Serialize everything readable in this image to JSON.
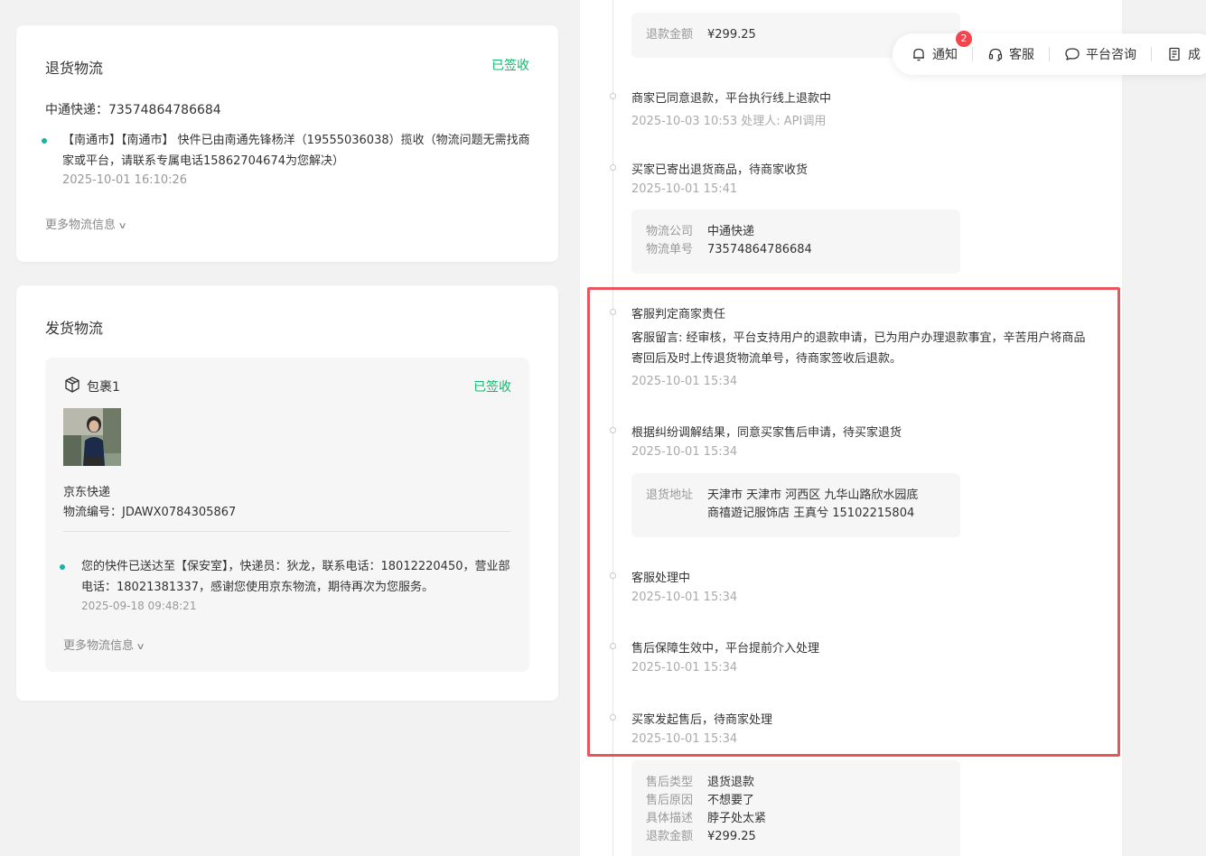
{
  "return_logistics": {
    "title": "退货物流",
    "status": "已签收",
    "tracking": "中通快递：73574864786684",
    "log_text": "【南通市】【南通市】 快件已由南通先锋杨洋（19555036038）揽收（物流问题无需找商家或平台，请联系专属电话15862704674为您解决）",
    "log_time": "2025-10-01 16:10:26",
    "more": "更多物流信息"
  },
  "ship_logistics": {
    "title": "发货物流",
    "package": {
      "label": "包裹1",
      "status": "已签收",
      "carrier": "京东快递",
      "tracking": "物流编号：JDAWX0784305867",
      "log_text": "您的快件已送达至【保安室】，快递员：狄龙，联系电话：18012220450，营业部电话：18021381337，感谢您使用京东物流，期待再次为您服务。",
      "log_time": "2025-09-18 09:48:21",
      "more": "更多物流信息"
    }
  },
  "timeline": {
    "top_box": {
      "label": "退款金额",
      "value": "¥299.25"
    },
    "e1": {
      "title": "商家已同意退款，平台执行线上退款中",
      "time": "2025-10-03 10:53 处理人: API调用"
    },
    "e2": {
      "title": "买家已寄出退货商品，待商家收货",
      "time": "2025-10-01 15:41"
    },
    "e2_box": {
      "company_label": "物流公司",
      "company": "中通快递",
      "no_label": "物流单号",
      "no": "73574864786684"
    },
    "e3": {
      "title": "客服判定商家责任",
      "msg": "客服留言: 经审核，平台支持用户的退款申请，已为用户办理退款事宜，辛苦用户将商品寄回后及时上传退货物流单号，待商家签收后退款。",
      "time": "2025-10-01 15:34"
    },
    "e4": {
      "title": "根据纠纷调解结果，同意买家售后申请，待买家退货",
      "time": "2025-10-01 15:34"
    },
    "e4_box": {
      "label": "退货地址",
      "line1": "天津市 天津市 河西区 九华山路欣水园底",
      "line2": "商禧遊记服饰店 王真兮 15102215804"
    },
    "e5": {
      "title": "客服处理中",
      "time": "2025-10-01 15:34"
    },
    "e6": {
      "title": "售后保障生效中，平台提前介入处理",
      "time": "2025-10-01 15:34"
    },
    "e7": {
      "title": "买家发起售后，待商家处理",
      "time": "2025-10-01 15:34"
    },
    "bottom_box": {
      "type_label": "售后类型",
      "type": "退货退款",
      "reason_label": "售后原因",
      "reason": "不想要了",
      "desc_label": "具体描述",
      "desc": "脖子处太紧",
      "amount_label": "退款金额",
      "amount": "¥299.25"
    }
  },
  "toolbar": {
    "notify": "通知",
    "notify_count": "2",
    "service": "客服",
    "consult": "平台咨询",
    "more": "成"
  },
  "colors": {
    "green_status": "#13b96e",
    "teal_dot": "#18b3a6",
    "highlight_border": "#e9555c",
    "badge": "#f4454e"
  }
}
